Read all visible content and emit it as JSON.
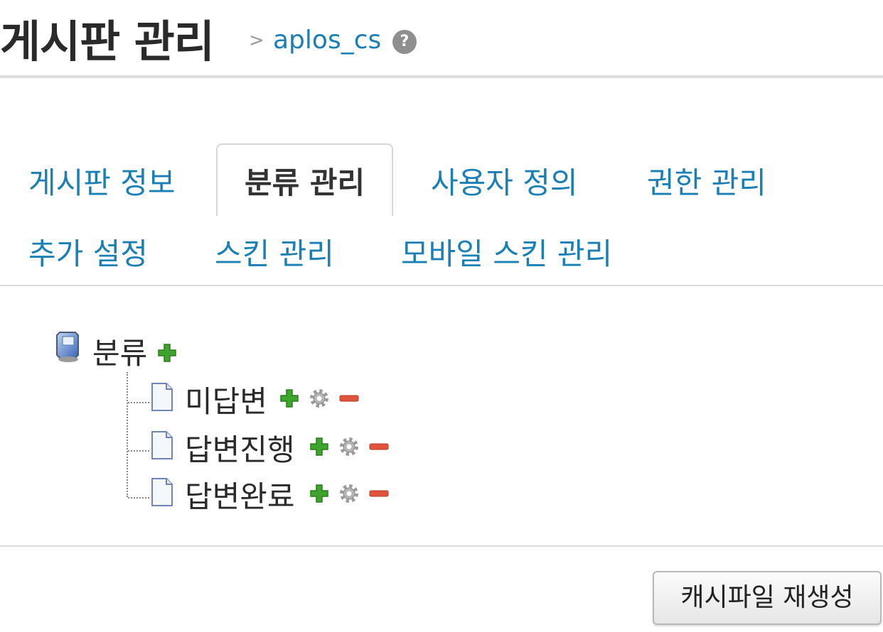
{
  "header": {
    "title": "게시판 관리",
    "separator": ">",
    "module_name": "aplos_cs",
    "help_symbol": "?"
  },
  "tabs": [
    {
      "label": "게시판 정보",
      "active": false
    },
    {
      "label": "분류 관리",
      "active": true
    },
    {
      "label": "사용자 정의",
      "active": false
    },
    {
      "label": "권한 관리",
      "active": false
    },
    {
      "label": "추가 설정",
      "active": false
    },
    {
      "label": "스킨 관리",
      "active": false
    },
    {
      "label": "모바일 스킨 관리",
      "active": false
    }
  ],
  "tree": {
    "root_label": "분류",
    "root_icon": "computer-icon",
    "nodes": [
      {
        "label": "미답변"
      },
      {
        "label": "답변진행"
      },
      {
        "label": "답변완료"
      }
    ],
    "icons": {
      "add": "add-icon",
      "settings": "gear-icon",
      "delete": "remove-icon",
      "node": "document-icon"
    }
  },
  "footer": {
    "regen_button": "캐시파일 재생성"
  },
  "colors": {
    "link": "#1a7fb5",
    "add": "#3ea52c",
    "delete": "#e0533c",
    "divider": "#dcdcdc"
  }
}
